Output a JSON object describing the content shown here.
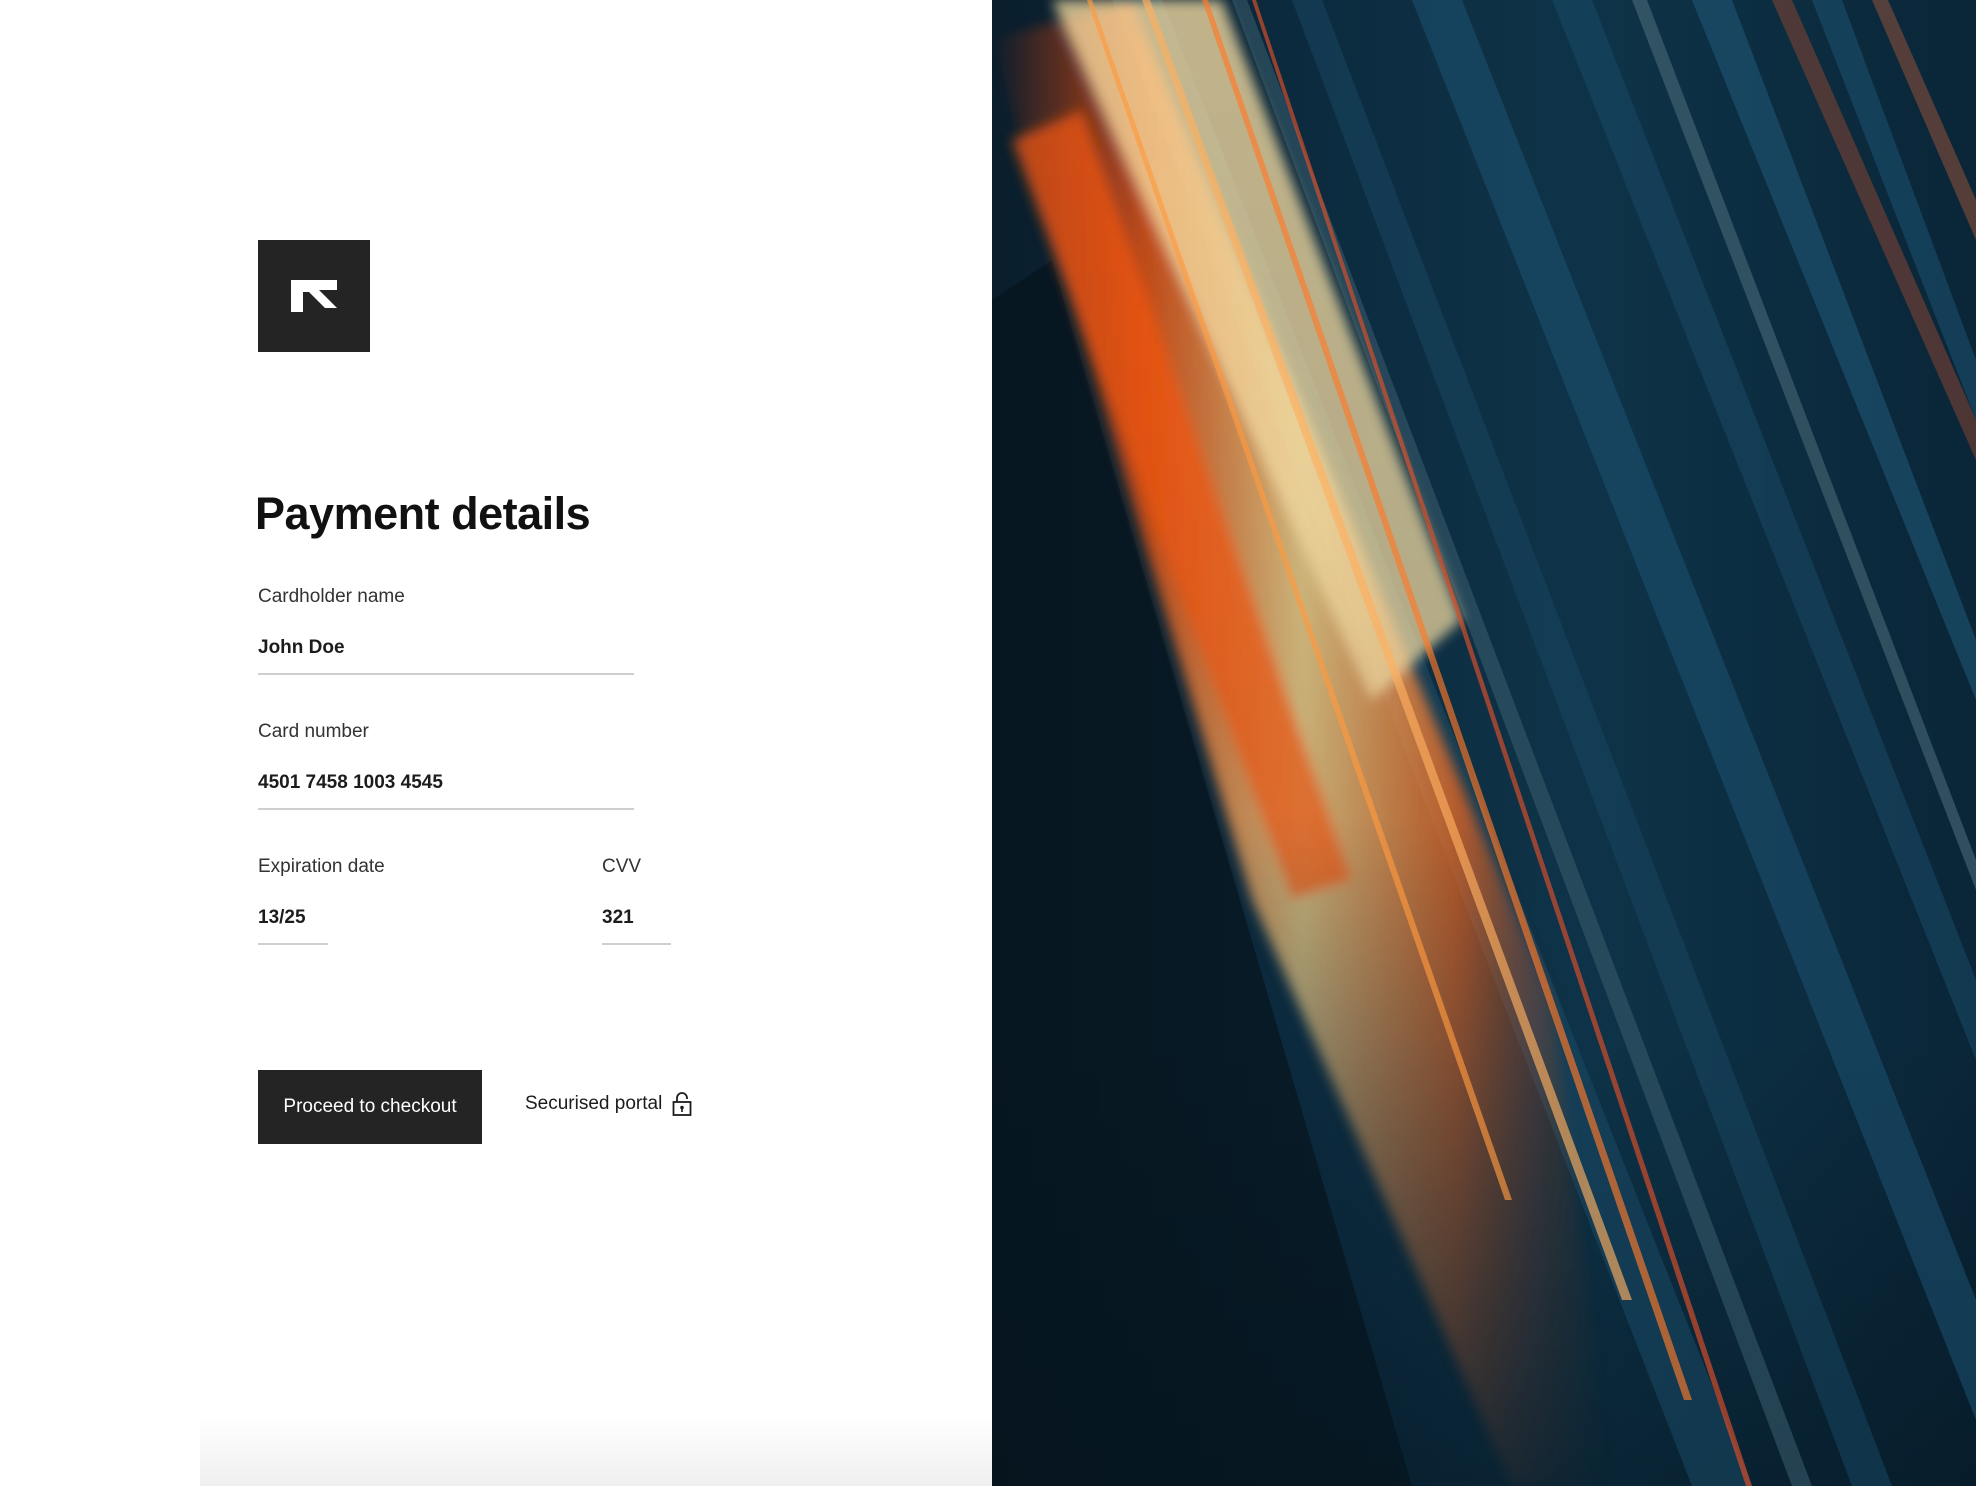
{
  "brand": {
    "logo_icon": "brand-monogram-icon"
  },
  "form": {
    "title": "Payment details",
    "cardholder": {
      "label": "Cardholder name",
      "value": "John Doe"
    },
    "card_number": {
      "label": "Card number",
      "value": "4501 7458 1003 4545"
    },
    "expiration": {
      "label": "Expiration date",
      "value": "13/25"
    },
    "cvv": {
      "label": "CVV",
      "value": "321"
    },
    "submit_label": "Proceed to checkout",
    "secure_text": "Securised portal",
    "secure_icon": "lock-icon"
  },
  "colors": {
    "button_bg": "#242424",
    "button_text": "#ffffff",
    "heading": "#111111",
    "underline": "#cfcfcf",
    "hero_orange": "#ff6a1a",
    "hero_teal": "#0e3348"
  },
  "hero": {
    "description_icon": "abstract-light-streaks-image"
  }
}
